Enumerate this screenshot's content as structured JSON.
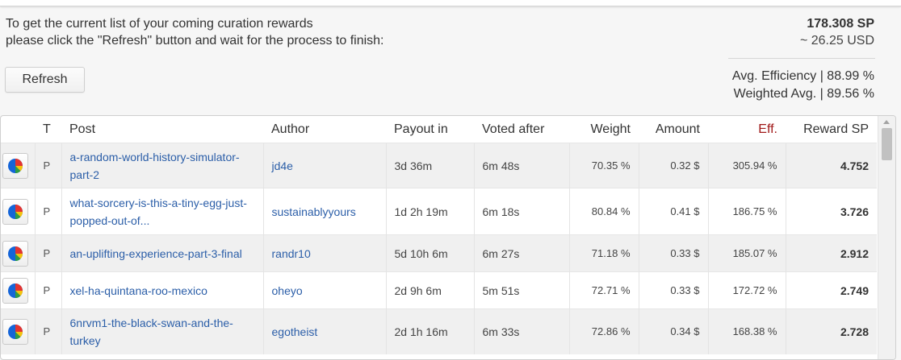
{
  "intro": {
    "line1": "To get the current list of your coming curation rewards",
    "line2": "please click the \"Refresh\" button and wait for the process to finish:"
  },
  "summary": {
    "sp_total": "178.308 SP",
    "usd_total": "~ 26.25 USD",
    "avg_efficiency": "Avg. Efficiency | 88.99 %",
    "weighted_avg": "Weighted Avg. | 89.56 %"
  },
  "refresh_label": "Refresh",
  "table": {
    "headers": {
      "type": "T",
      "post": "Post",
      "author": "Author",
      "payout": "Payout in",
      "voted_after": "Voted after",
      "weight": "Weight",
      "amount": "Amount",
      "eff": "Eff.",
      "reward": "Reward SP"
    },
    "rows": [
      {
        "type": "P",
        "post_line1": "a-random-world-history-simulator-",
        "post_line2": "part-2",
        "author": "jd4e",
        "payout": "3d 36m",
        "voted_after": "6m 48s",
        "weight": "70.35 %",
        "amount": "0.32 $",
        "eff": "305.94 %",
        "reward": "4.752"
      },
      {
        "type": "P",
        "post_line1": "what-sorcery-is-this-a-tiny-egg-just-",
        "post_line2": "popped-out-of...",
        "author": "sustainablyyours",
        "payout": "1d 2h 19m",
        "voted_after": "6m 18s",
        "weight": "80.84 %",
        "amount": "0.41 $",
        "eff": "186.75 %",
        "reward": "3.726"
      },
      {
        "type": "P",
        "post_line1": "an-uplifting-experience-part-3-final",
        "post_line2": "",
        "author": "randr10",
        "payout": "5d 10h 6m",
        "voted_after": "6m 27s",
        "weight": "71.18 %",
        "amount": "0.33 $",
        "eff": "185.07 %",
        "reward": "2.912"
      },
      {
        "type": "P",
        "post_line1": "xel-ha-quintana-roo-mexico",
        "post_line2": "",
        "author": "oheyo",
        "payout": "2d 9h 6m",
        "voted_after": "5m 51s",
        "weight": "72.71 %",
        "amount": "0.33 $",
        "eff": "172.72 %",
        "reward": "2.749"
      },
      {
        "type": "P",
        "post_line1": "6nrvm1-the-black-swan-and-the-",
        "post_line2": "turkey",
        "author": "egotheist",
        "payout": "2d 1h 16m",
        "voted_after": "6m 33s",
        "weight": "72.86 %",
        "amount": "0.34 $",
        "eff": "168.38 %",
        "reward": "2.728"
      }
    ]
  },
  "icons": {
    "row_action": "pie-chart-icon"
  },
  "colors": {
    "link": "#2b5ea8",
    "eff_header": "#a01818",
    "pie_blue": "#1565d8",
    "pie_red": "#e3342f",
    "pie_yellow": "#f4c20d",
    "pie_green": "#2f9e44"
  }
}
